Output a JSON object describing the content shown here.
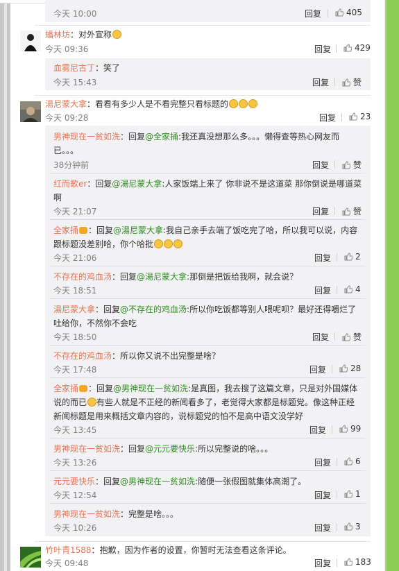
{
  "ui": {
    "reply_label": "回复",
    "thumb_icon": "thumb-up-icon",
    "colors": {
      "nickname": "#eb7350",
      "mention": "#2f8f1f",
      "sidebar": "#8ccd55"
    }
  },
  "comments": [
    {
      "time": "今天 10:00",
      "likes": "405"
    },
    {
      "nick": "蟠林坊",
      "sep": "：",
      "text": "对外宣称",
      "time": "今天 09:36",
      "likes": "429",
      "replies": [
        {
          "nick": "血雾尼古丁",
          "sep": "：",
          "text": "笑了",
          "time": "今天 15:43",
          "likes": "赞"
        }
      ]
    },
    {
      "nick": "湯尼蒙大拿",
      "sep": "：",
      "text": "看看有多少人是不看完整只看标题的",
      "time": "今天 09:28",
      "likes": "23"
    },
    {
      "nick": "竹叶青1588",
      "sep": "：",
      "text": "抱歉，因为作者的设置，你暂时无法查看这条评论。",
      "time": "今天 09:48",
      "likes": "183"
    }
  ],
  "replies": [
    {
      "nick": "男神现在一贫如洗",
      "pre": "：回复",
      "at": "@全家捅",
      "text": ":我还真没想那么多。。。懒得查等热心网友而",
      "text2": "已。。。",
      "time": "38分钟前",
      "likes": "赞"
    },
    {
      "nick": "红而歌er",
      "pre": "：回复",
      "at": "@湯尼蒙大拿",
      "text": ":人家饭端上来了 你非说不是这道菜 那你倒说是哪道菜",
      "text2": "啊",
      "time": "今天 21:07",
      "likes": "赞"
    },
    {
      "nick": "全家捅",
      "pre": "：回复",
      "at": "@湯尼蒙大拿",
      "text": ":我自己亲手去端了饭吃完了哈，所以我可以说，内容",
      "text2": "跟标题没差别哈，你个哈批",
      "time": "今天 21:06",
      "likes": "2"
    },
    {
      "nick": "不存在的鸡血汤",
      "pre": "：回复",
      "at": "@湯尼蒙大拿",
      "text": ":那倒是把饭给我啊，就会说？",
      "time": "今天 18:51",
      "likes": "4"
    },
    {
      "nick": "湯尼蒙大拿",
      "pre": "：回复",
      "at": "@不存在的鸡血汤",
      "text": ":所以你吃饭都等别人喂呢呗？最好还得嚼烂了",
      "text2": "吐给你，不然你不会吃",
      "time": "今天 18:50",
      "likes": "赞"
    },
    {
      "nick": "不存在的鸡血汤",
      "pre": "：",
      "text": "所以你又说不出完整是啥？",
      "time": "今天 17:48",
      "likes": "28"
    },
    {
      "nick": "全家捅",
      "pre": "：回复",
      "at": "@男神现在一贫如洗",
      "text": ":是真图，我去搜了这篇文章，只是对外国媒体",
      "text2": "说的而已",
      "text2b": "有些人就是不正经的新闻看多了，老觉得大家都是标题党。像这种正经",
      "text3": "新闻标题是用来概括文章内容的，说标题党的怕不是高中语文没学好",
      "time": "今天 13:45",
      "likes": "99"
    },
    {
      "nick": "男神现在一贫如洗",
      "pre": "：回复",
      "at": "@元元要快乐",
      "text": ":所以完整说的啥。。。",
      "time": "今天 13:26",
      "likes": "6"
    },
    {
      "nick": "元元要快乐",
      "pre": "：回复",
      "at": "@男神现在一贫如洗",
      "text": ":随便一张假图就集体高潮了。",
      "time": "今天 12:54",
      "likes": "1"
    },
    {
      "nick": "男神现在一贫如洗",
      "pre": "：",
      "text": "完整是啥。。。",
      "time": "今天 10:26",
      "likes": "3"
    }
  ]
}
